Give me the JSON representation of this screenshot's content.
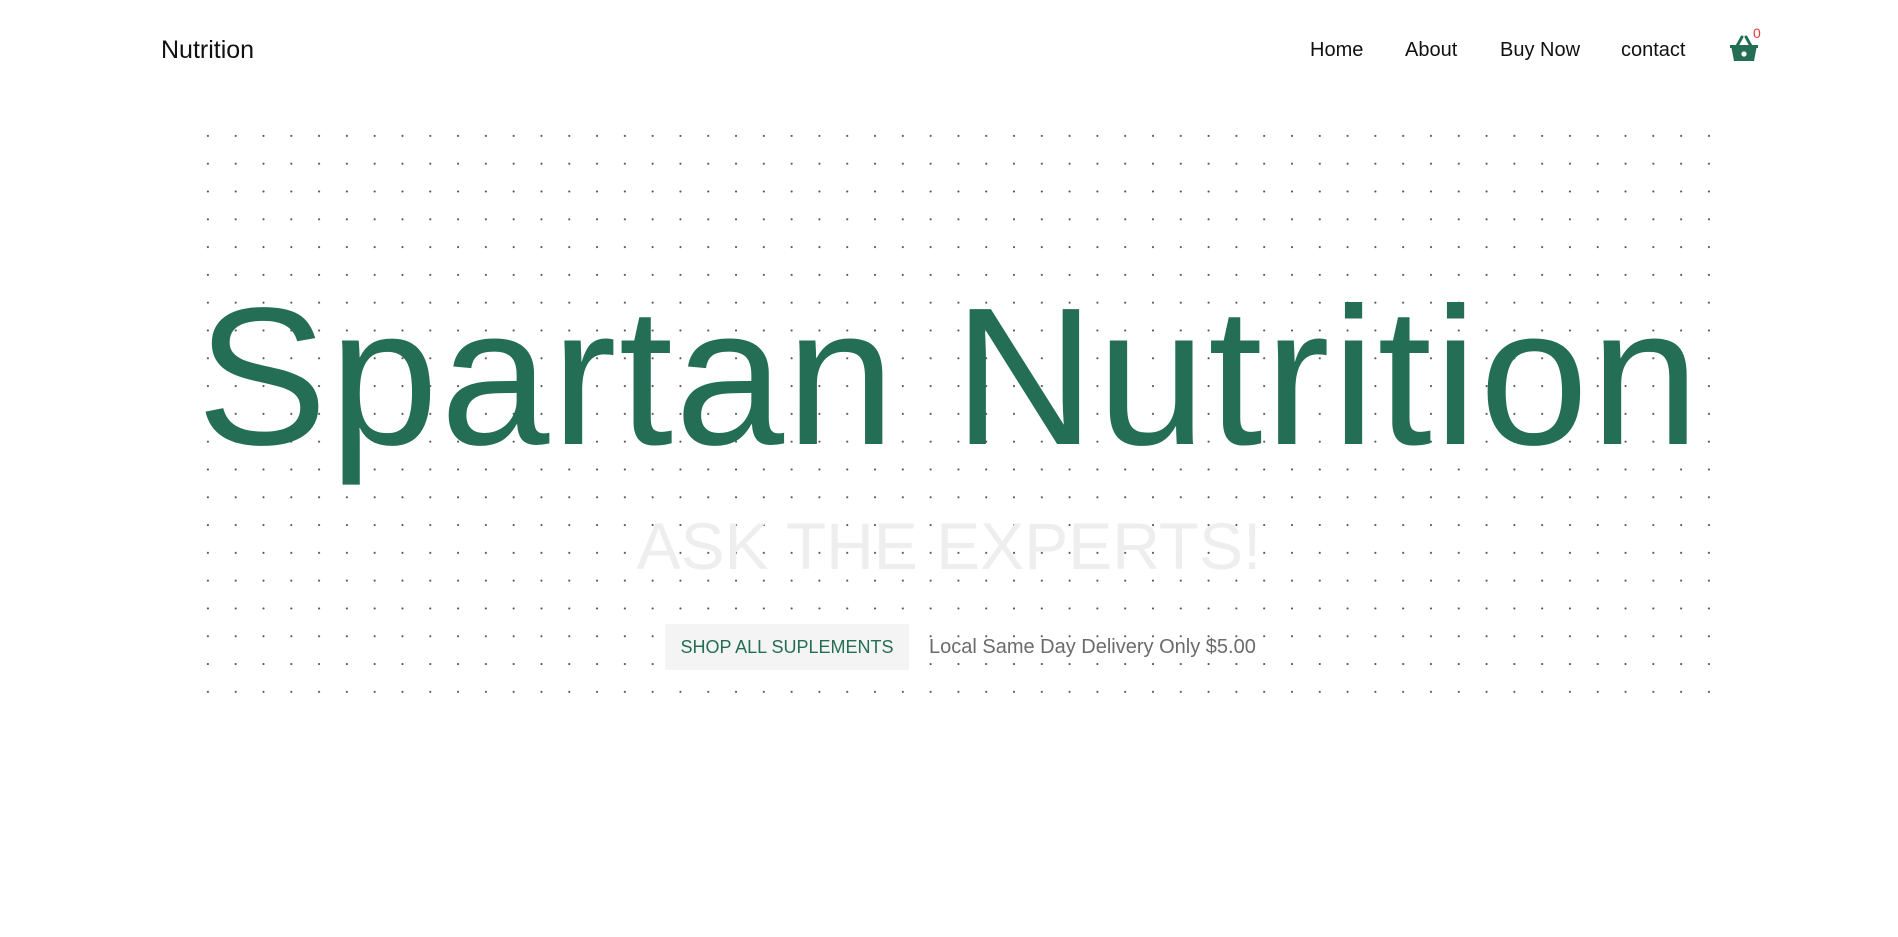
{
  "header": {
    "brand": "Nutrition",
    "nav": [
      "Home",
      "About",
      "Buy Now",
      "contact"
    ],
    "cart_count": "0",
    "cart_icon": "shopping-basket-icon"
  },
  "hero": {
    "title": "Spartan Nutrition",
    "subtitle": "ASK THE EXPERTS!",
    "shop_button": "SHOP ALL SUPLEMENTS",
    "delivery_text": "Local Same Day Delivery Only $5.00"
  },
  "colors": {
    "brand_green": "#246e55",
    "cart_badge": "#e53935",
    "subtitle": "#eeeeee",
    "button_bg": "#f4f4f4",
    "delivery_text": "#6b6b6b"
  }
}
